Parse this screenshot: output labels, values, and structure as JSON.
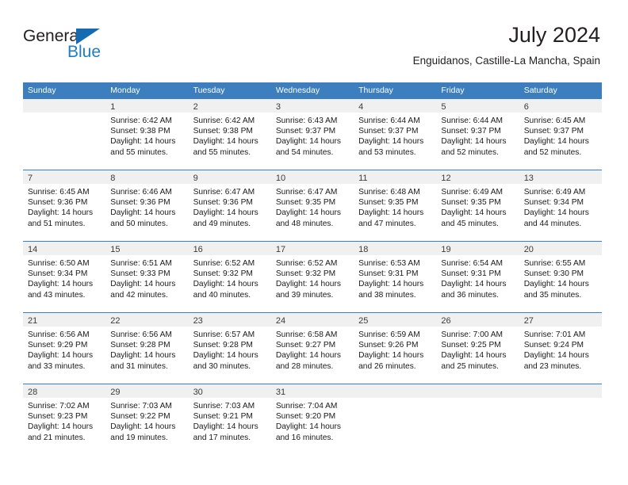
{
  "brand": {
    "word_one": "General",
    "word_two": "Blue",
    "logo_icon": "blue-triangle-icon"
  },
  "header": {
    "title": "July 2024",
    "subtitle": "Enguidanos, Castille-La Mancha, Spain"
  },
  "colors": {
    "header_blue": "#3d7ebf",
    "brand_blue": "#1f7dc4",
    "day_strip": "#f0f0f0",
    "text": "#231f20"
  },
  "weekdays": [
    "Sunday",
    "Monday",
    "Tuesday",
    "Wednesday",
    "Thursday",
    "Friday",
    "Saturday"
  ],
  "weeks": [
    [
      {
        "day": "",
        "sunrise": "",
        "sunset": "",
        "daylight1": "",
        "daylight2": ""
      },
      {
        "day": "1",
        "sunrise": "Sunrise: 6:42 AM",
        "sunset": "Sunset: 9:38 PM",
        "daylight1": "Daylight: 14 hours",
        "daylight2": "and 55 minutes."
      },
      {
        "day": "2",
        "sunrise": "Sunrise: 6:42 AM",
        "sunset": "Sunset: 9:38 PM",
        "daylight1": "Daylight: 14 hours",
        "daylight2": "and 55 minutes."
      },
      {
        "day": "3",
        "sunrise": "Sunrise: 6:43 AM",
        "sunset": "Sunset: 9:37 PM",
        "daylight1": "Daylight: 14 hours",
        "daylight2": "and 54 minutes."
      },
      {
        "day": "4",
        "sunrise": "Sunrise: 6:44 AM",
        "sunset": "Sunset: 9:37 PM",
        "daylight1": "Daylight: 14 hours",
        "daylight2": "and 53 minutes."
      },
      {
        "day": "5",
        "sunrise": "Sunrise: 6:44 AM",
        "sunset": "Sunset: 9:37 PM",
        "daylight1": "Daylight: 14 hours",
        "daylight2": "and 52 minutes."
      },
      {
        "day": "6",
        "sunrise": "Sunrise: 6:45 AM",
        "sunset": "Sunset: 9:37 PM",
        "daylight1": "Daylight: 14 hours",
        "daylight2": "and 52 minutes."
      }
    ],
    [
      {
        "day": "7",
        "sunrise": "Sunrise: 6:45 AM",
        "sunset": "Sunset: 9:36 PM",
        "daylight1": "Daylight: 14 hours",
        "daylight2": "and 51 minutes."
      },
      {
        "day": "8",
        "sunrise": "Sunrise: 6:46 AM",
        "sunset": "Sunset: 9:36 PM",
        "daylight1": "Daylight: 14 hours",
        "daylight2": "and 50 minutes."
      },
      {
        "day": "9",
        "sunrise": "Sunrise: 6:47 AM",
        "sunset": "Sunset: 9:36 PM",
        "daylight1": "Daylight: 14 hours",
        "daylight2": "and 49 minutes."
      },
      {
        "day": "10",
        "sunrise": "Sunrise: 6:47 AM",
        "sunset": "Sunset: 9:35 PM",
        "daylight1": "Daylight: 14 hours",
        "daylight2": "and 48 minutes."
      },
      {
        "day": "11",
        "sunrise": "Sunrise: 6:48 AM",
        "sunset": "Sunset: 9:35 PM",
        "daylight1": "Daylight: 14 hours",
        "daylight2": "and 47 minutes."
      },
      {
        "day": "12",
        "sunrise": "Sunrise: 6:49 AM",
        "sunset": "Sunset: 9:35 PM",
        "daylight1": "Daylight: 14 hours",
        "daylight2": "and 45 minutes."
      },
      {
        "day": "13",
        "sunrise": "Sunrise: 6:49 AM",
        "sunset": "Sunset: 9:34 PM",
        "daylight1": "Daylight: 14 hours",
        "daylight2": "and 44 minutes."
      }
    ],
    [
      {
        "day": "14",
        "sunrise": "Sunrise: 6:50 AM",
        "sunset": "Sunset: 9:34 PM",
        "daylight1": "Daylight: 14 hours",
        "daylight2": "and 43 minutes."
      },
      {
        "day": "15",
        "sunrise": "Sunrise: 6:51 AM",
        "sunset": "Sunset: 9:33 PM",
        "daylight1": "Daylight: 14 hours",
        "daylight2": "and 42 minutes."
      },
      {
        "day": "16",
        "sunrise": "Sunrise: 6:52 AM",
        "sunset": "Sunset: 9:32 PM",
        "daylight1": "Daylight: 14 hours",
        "daylight2": "and 40 minutes."
      },
      {
        "day": "17",
        "sunrise": "Sunrise: 6:52 AM",
        "sunset": "Sunset: 9:32 PM",
        "daylight1": "Daylight: 14 hours",
        "daylight2": "and 39 minutes."
      },
      {
        "day": "18",
        "sunrise": "Sunrise: 6:53 AM",
        "sunset": "Sunset: 9:31 PM",
        "daylight1": "Daylight: 14 hours",
        "daylight2": "and 38 minutes."
      },
      {
        "day": "19",
        "sunrise": "Sunrise: 6:54 AM",
        "sunset": "Sunset: 9:31 PM",
        "daylight1": "Daylight: 14 hours",
        "daylight2": "and 36 minutes."
      },
      {
        "day": "20",
        "sunrise": "Sunrise: 6:55 AM",
        "sunset": "Sunset: 9:30 PM",
        "daylight1": "Daylight: 14 hours",
        "daylight2": "and 35 minutes."
      }
    ],
    [
      {
        "day": "21",
        "sunrise": "Sunrise: 6:56 AM",
        "sunset": "Sunset: 9:29 PM",
        "daylight1": "Daylight: 14 hours",
        "daylight2": "and 33 minutes."
      },
      {
        "day": "22",
        "sunrise": "Sunrise: 6:56 AM",
        "sunset": "Sunset: 9:28 PM",
        "daylight1": "Daylight: 14 hours",
        "daylight2": "and 31 minutes."
      },
      {
        "day": "23",
        "sunrise": "Sunrise: 6:57 AM",
        "sunset": "Sunset: 9:28 PM",
        "daylight1": "Daylight: 14 hours",
        "daylight2": "and 30 minutes."
      },
      {
        "day": "24",
        "sunrise": "Sunrise: 6:58 AM",
        "sunset": "Sunset: 9:27 PM",
        "daylight1": "Daylight: 14 hours",
        "daylight2": "and 28 minutes."
      },
      {
        "day": "25",
        "sunrise": "Sunrise: 6:59 AM",
        "sunset": "Sunset: 9:26 PM",
        "daylight1": "Daylight: 14 hours",
        "daylight2": "and 26 minutes."
      },
      {
        "day": "26",
        "sunrise": "Sunrise: 7:00 AM",
        "sunset": "Sunset: 9:25 PM",
        "daylight1": "Daylight: 14 hours",
        "daylight2": "and 25 minutes."
      },
      {
        "day": "27",
        "sunrise": "Sunrise: 7:01 AM",
        "sunset": "Sunset: 9:24 PM",
        "daylight1": "Daylight: 14 hours",
        "daylight2": "and 23 minutes."
      }
    ],
    [
      {
        "day": "28",
        "sunrise": "Sunrise: 7:02 AM",
        "sunset": "Sunset: 9:23 PM",
        "daylight1": "Daylight: 14 hours",
        "daylight2": "and 21 minutes."
      },
      {
        "day": "29",
        "sunrise": "Sunrise: 7:03 AM",
        "sunset": "Sunset: 9:22 PM",
        "daylight1": "Daylight: 14 hours",
        "daylight2": "and 19 minutes."
      },
      {
        "day": "30",
        "sunrise": "Sunrise: 7:03 AM",
        "sunset": "Sunset: 9:21 PM",
        "daylight1": "Daylight: 14 hours",
        "daylight2": "and 17 minutes."
      },
      {
        "day": "31",
        "sunrise": "Sunrise: 7:04 AM",
        "sunset": "Sunset: 9:20 PM",
        "daylight1": "Daylight: 14 hours",
        "daylight2": "and 16 minutes."
      },
      {
        "day": "",
        "sunrise": "",
        "sunset": "",
        "daylight1": "",
        "daylight2": ""
      },
      {
        "day": "",
        "sunrise": "",
        "sunset": "",
        "daylight1": "",
        "daylight2": ""
      },
      {
        "day": "",
        "sunrise": "",
        "sunset": "",
        "daylight1": "",
        "daylight2": ""
      }
    ]
  ]
}
